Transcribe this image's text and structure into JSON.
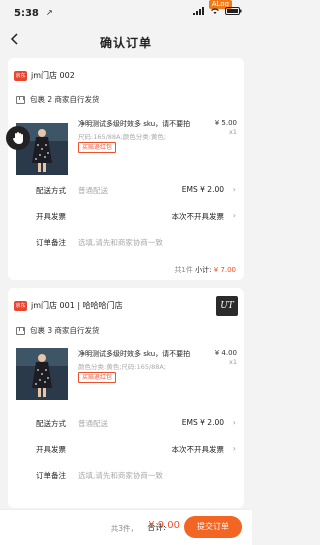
{
  "status": {
    "time": "5:38",
    "location_arrow": "↗",
    "badge": "ALog"
  },
  "nav": {
    "title": "确认订单"
  },
  "orders": [
    {
      "shop_logo": "京东",
      "shop_name": "jm门店 002",
      "package": "包裹 2 商家自行发货",
      "product_name": "净明测试多级时效多 sku，请不要拍",
      "product_spec": "尺码:165/88A;颜色分类:黄色;",
      "product_badge": "买赔退红包",
      "price": "¥ 5.00",
      "qty": "x1",
      "shipping_label": "配送方式",
      "shipping_mid": "普通配送",
      "shipping_value": "EMS ¥ 2.00",
      "invoice_label": "开具发票",
      "invoice_value": "本次不开具发票",
      "remark_label": "订单备注",
      "remark_placeholder": "选填,请先和商家协商一致",
      "count": "共1件",
      "subtotal_label": "小计:",
      "subtotal_value": "¥ 7.00"
    },
    {
      "shop_logo": "京东",
      "shop_name": "jm门店 001 | 哈哈哈门店",
      "package": "包裹 3 商家自行发货",
      "product_name": "净明测试多级时效多 sku，请不要拍",
      "product_spec": "颜色分类:黄色;尺码:165/88A;",
      "product_badge": "买赔退红包",
      "price": "¥ 4.00",
      "qty": "x1",
      "shipping_label": "配送方式",
      "shipping_mid": "普通配送",
      "shipping_value": "EMS ¥ 2.00",
      "invoice_label": "开具发票",
      "invoice_value": "本次不开具发票",
      "remark_label": "订单备注",
      "remark_placeholder": "选填,请先和商家协商一致"
    }
  ],
  "ut_badge": "UT",
  "bottom": {
    "count": "共3件，",
    "total_label": "合计:",
    "total_value": "¥ 9.00",
    "submit": "提交订单"
  },
  "colors": {
    "accent": "#f26522",
    "price": "#f0512b"
  }
}
